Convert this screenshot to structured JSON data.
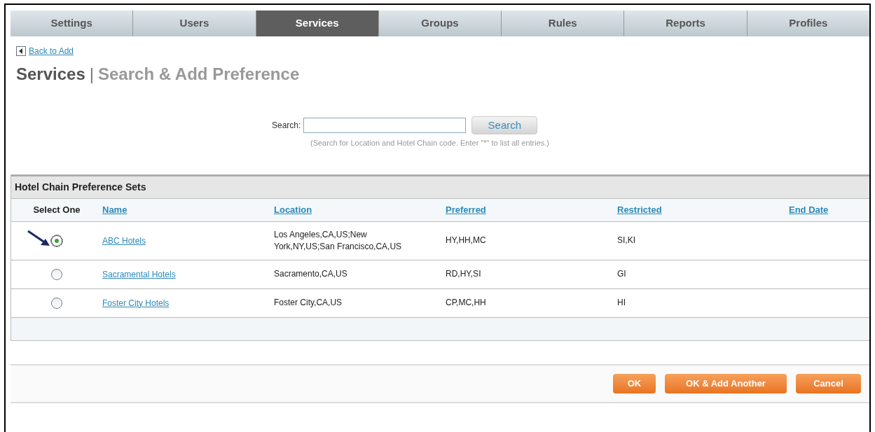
{
  "tabs": [
    {
      "label": "Settings",
      "selected": false
    },
    {
      "label": "Users",
      "selected": false
    },
    {
      "label": "Services",
      "selected": true
    },
    {
      "label": "Groups",
      "selected": false
    },
    {
      "label": "Rules",
      "selected": false
    },
    {
      "label": "Reports",
      "selected": false
    },
    {
      "label": "Profiles",
      "selected": false
    }
  ],
  "back_link": "Back to Add",
  "title": {
    "section": "Services",
    "separator": "|",
    "subtitle": "Search & Add Preference"
  },
  "search": {
    "label": "Search:",
    "button": "Search",
    "hint": "(Search for Location and Hotel Chain code. Enter \"*\" to list all entries.)"
  },
  "table": {
    "title": "Hotel Chain Preference Sets",
    "columns": [
      {
        "label": "Select One",
        "sortable": false
      },
      {
        "label": "Name",
        "sortable": true
      },
      {
        "label": "Location",
        "sortable": true
      },
      {
        "label": "Preferred",
        "sortable": true
      },
      {
        "label": "Restricted",
        "sortable": true
      },
      {
        "label": "End Date",
        "sortable": true
      }
    ],
    "rows": [
      {
        "selected": true,
        "name": "ABC Hotels",
        "location": "Los Angeles,CA,US;New York,NY,US;San Francisco,CA,US",
        "preferred": "HY,HH,MC",
        "restricted": "SI,KI"
      },
      {
        "selected": false,
        "name": "Sacramental Hotels",
        "location": "Sacramento,CA,US",
        "preferred": "RD,HY,SI",
        "restricted": "GI"
      },
      {
        "selected": false,
        "name": "Foster City Hotels",
        "location": "Foster City,CA,US",
        "preferred": "CP,MC,HH",
        "restricted": "HI"
      }
    ]
  },
  "buttons": [
    "OK",
    "OK & Add Another",
    "Cancel"
  ]
}
